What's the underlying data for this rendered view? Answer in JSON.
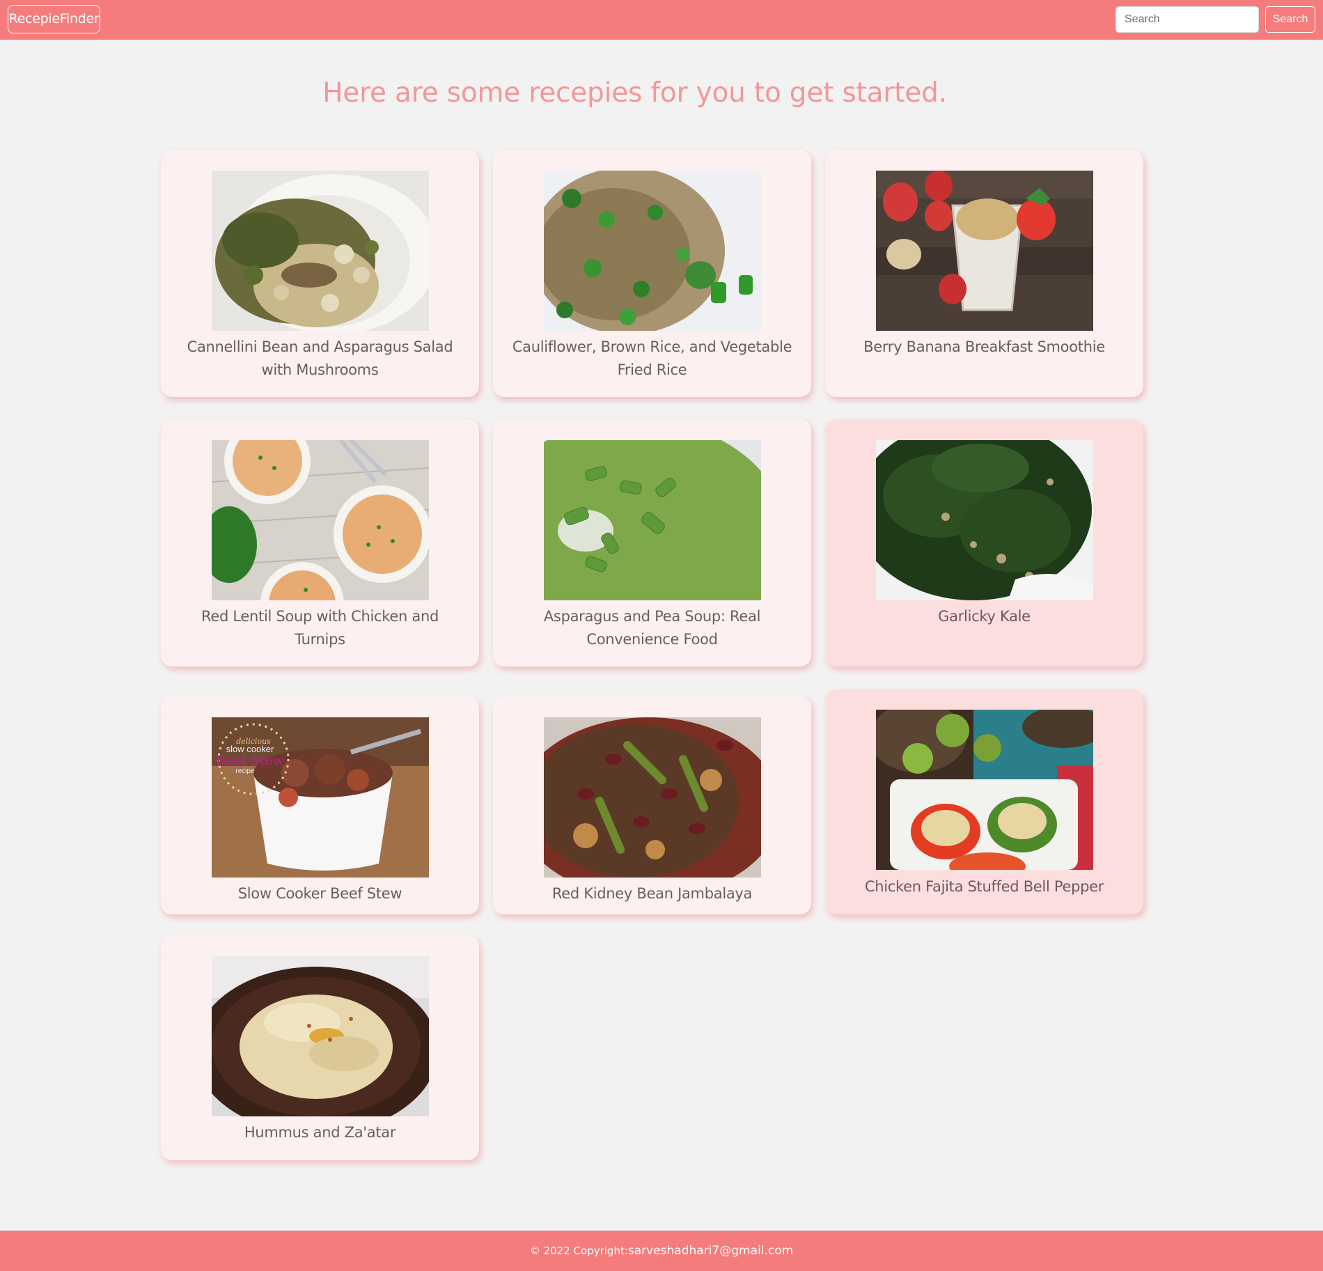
{
  "navbar": {
    "brand": "RecepieFinder",
    "search_placeholder": "Search",
    "search_button": "Search",
    "background": "#f47c7c"
  },
  "heading": "Here are some recepies for you to get started.",
  "recipes": [
    {
      "title": "Cannellini Bean and Asparagus Salad with Mushrooms",
      "image": "bean-asparagus-salad-photo"
    },
    {
      "title": "Cauliflower, Brown Rice, and Vegetable Fried Rice",
      "image": "fried-rice-photo"
    },
    {
      "title": "Berry Banana Breakfast Smoothie",
      "image": "smoothie-photo"
    },
    {
      "title": "Red Lentil Soup with Chicken and Turnips",
      "image": "lentil-soup-photo"
    },
    {
      "title": "Asparagus and Pea Soup: Real Convenience Food",
      "image": "pea-soup-photo"
    },
    {
      "title": "Garlicky Kale",
      "image": "kale-photo"
    },
    {
      "title": "Slow Cooker Beef Stew",
      "image": "beef-stew-photo",
      "photo_text": [
        "delicious",
        "slow cooker",
        "Beef Stew",
        "recipe"
      ]
    },
    {
      "title": "Red Kidney Bean Jambalaya",
      "image": "jambalaya-photo"
    },
    {
      "title": "Chicken Fajita Stuffed Bell Pepper",
      "image": "stuffed-pepper-photo"
    },
    {
      "title": "Hummus and Za'atar",
      "image": "hummus-photo"
    }
  ],
  "footer": {
    "copyright": "© 2022 Copyright:",
    "email": "sarveshadhari7@gmail.com"
  },
  "colors": {
    "accent": "#f47c7c",
    "heading": "#f29797",
    "card": "#fdf0f0",
    "card_hover": "#fcdede",
    "page": "#f3f2f2"
  }
}
